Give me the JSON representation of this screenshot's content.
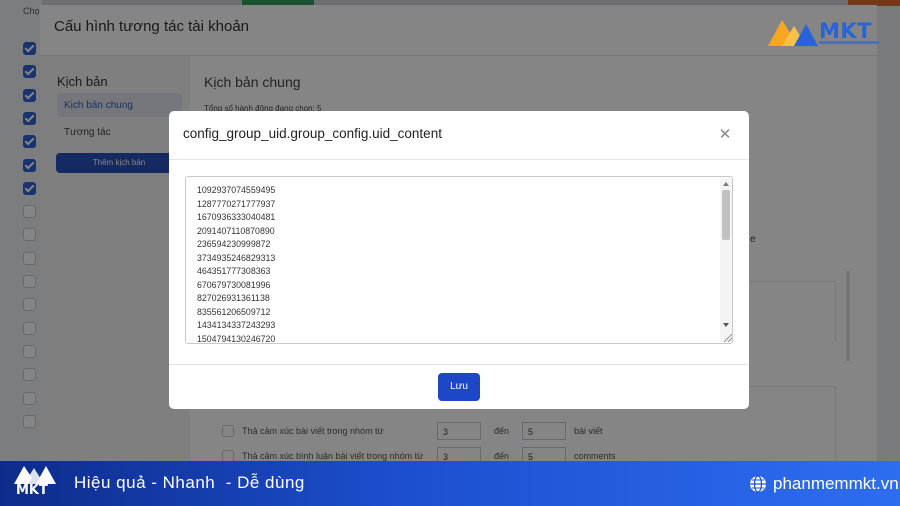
{
  "background_app": {
    "select_label": "Chọ",
    "window_title": "Cấu hình tương tác tài khoản",
    "sidebar": {
      "heading": "Kịch bản",
      "items": [
        {
          "label": "Kịch bản chung",
          "active": true
        },
        {
          "label": "Tương tác",
          "active": false
        }
      ],
      "add_button": "Thêm kịch bản"
    },
    "main": {
      "heading": "Kịch bản chung",
      "selected_count": "Tổng số hành động đang chọn: 5",
      "stray_letter": "e",
      "rows": [
        {
          "label": "Thả cảm xúc bài viết trong nhóm từ",
          "from": "3",
          "to_label": "đến",
          "to": "5",
          "unit": "bài viết"
        },
        {
          "label": "Thả cảm xúc bình luận bài viết trong nhóm từ",
          "from": "3",
          "to_label": "đến",
          "to": "5",
          "unit": "comments"
        }
      ]
    },
    "checkbox_states": [
      true,
      true,
      true,
      true,
      true,
      true,
      true,
      false,
      false,
      false,
      false,
      false,
      false,
      false,
      false,
      false,
      false
    ]
  },
  "logo": {
    "text": "MKT"
  },
  "modal": {
    "title": "config_group_uid.group_config.uid_content",
    "close_icon": "close-icon",
    "uids": [
      "1092937074559495",
      "1287770271777937",
      "1670936333040481",
      "2091407110870890",
      "236594230999872",
      "3734935246829313",
      "464351777308363",
      "670679730081996",
      "827026931361138",
      "835561206509712",
      "1434134337243293",
      "1504794130246720"
    ],
    "save_label": "Lưu"
  },
  "brand_bar": {
    "logo_text": "MKT",
    "slogan": "Hiệu quả - Nhanh  - Dễ dùng",
    "website": "phanmemmkt.vn"
  },
  "colors": {
    "accent": "#1e47c8",
    "brand_blue": "#2a63d8",
    "logo_orange": "#f5a623"
  }
}
